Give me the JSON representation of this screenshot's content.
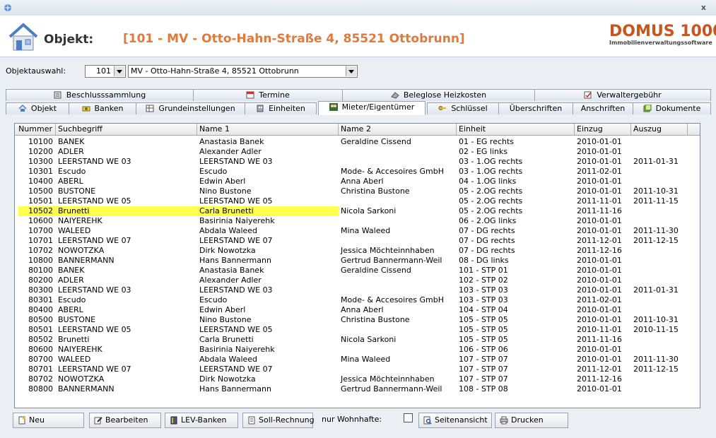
{
  "window": {
    "close_glyph": "x"
  },
  "header": {
    "label": "Objekt:",
    "title": "[101 - MV - Otto-Hahn-Straße 4, 85521 Ottobrunn]"
  },
  "logo": {
    "main": "DOMUS 1000",
    "reg": "®",
    "sub": "Immobilienverwaltungssoftware"
  },
  "selection": {
    "label": "Objektauswahl:",
    "number": "101",
    "text": "MV - Otto-Hahn-Straße 4, 85521 Ottobrunn"
  },
  "tabs_row1": [
    {
      "label": "Beschlusssammlung",
      "icon": "notebook-icon"
    },
    {
      "label": "Termine",
      "icon": "calendar-icon"
    },
    {
      "label": "Beleglose Heizkosten",
      "icon": "eraser-icon"
    },
    {
      "label": "Verwaltergebühr",
      "icon": "checklist-icon"
    }
  ],
  "tabs_row2": [
    {
      "label": "Objekt",
      "icon": "house-icon"
    },
    {
      "label": "Banken",
      "icon": "money-icon"
    },
    {
      "label": "Grundeinstellungen",
      "icon": "settings-grid-icon"
    },
    {
      "label": "Einheiten",
      "icon": "building-icon"
    },
    {
      "label": "Mieter/Eigentümer",
      "icon": "people-icon",
      "active": true
    },
    {
      "label": "Schlüssel",
      "icon": "key-icon"
    },
    {
      "label": "Überschriften",
      "icon": ""
    },
    {
      "label": "Anschriften",
      "icon": ""
    },
    {
      "label": "Dokumente",
      "icon": "documents-icon"
    }
  ],
  "table": {
    "columns": [
      "Nummer",
      "Suchbegriff",
      "Name 1",
      "Name 2",
      "Einheit",
      "Einzug",
      "Auszug"
    ],
    "rows": [
      [
        "10100",
        "BANEK",
        "Anastasia Banek",
        "Geraldine Cissend",
        "01 - EG rechts",
        "2010-01-01",
        ""
      ],
      [
        "10200",
        "ADLER",
        "Alexander Adler",
        "",
        "02 - EG links",
        "2010-01-01",
        ""
      ],
      [
        "10300",
        "LEERSTAND WE 03",
        "LEERSTAND WE 03",
        "",
        "03 - 1.OG rechts",
        "2010-01-01",
        "2011-01-31"
      ],
      [
        "10301",
        "Escudo",
        "Escudo",
        "Mode- & Accesoires GmbH",
        "03 - 1.OG rechts",
        "2011-02-01",
        ""
      ],
      [
        "10400",
        "ABERL",
        "Edwin Aberl",
        "Anna Aberl",
        "04 - 1.OG links",
        "2010-01-01",
        ""
      ],
      [
        "10500",
        "BUSTONE",
        "Nino Bustone",
        "Christina Bustone",
        "05 - 2.OG rechts",
        "2010-01-01",
        "2011-10-31"
      ],
      [
        "10501",
        "LEERSTAND WE 05",
        "LEERSTAND WE 05",
        "",
        "05 - 2.OG rechts",
        "2011-11-01",
        "2011-11-15"
      ],
      [
        "10502",
        "Brunetti",
        "Carla Brunetti",
        "Nicola Sarkoni",
        "05 - 2.OG rechts",
        "2011-11-16",
        ""
      ],
      [
        "10600",
        "NAIYEREHK",
        "Basirinia Naiyerehk",
        "",
        "06 - 2.OG links",
        "2010-01-01",
        ""
      ],
      [
        "10700",
        "WALEED",
        "Abdala Waleed",
        "Mina Waleed",
        "07 - DG rechts",
        "2010-01-01",
        "2011-11-30"
      ],
      [
        "10701",
        "LEERSTAND WE 07",
        "LEERSTAND WE 07",
        "",
        "07 - DG rechts",
        "2011-12-01",
        "2011-12-15"
      ],
      [
        "10702",
        "NOWOTZKA",
        "Dirk Nowotzka",
        "Jessica Möchteinnhaben",
        "07 - DG rechts",
        "2011-12-16",
        ""
      ],
      [
        "10800",
        "BANNERMANN",
        "Hans Bannermann",
        "Gertrud Bannermann-Weil",
        "08 - DG links",
        "2010-01-01",
        ""
      ],
      [
        "80100",
        "BANEK",
        "Anastasia Banek",
        "Geraldine Cissend",
        "101 - STP 01",
        "2010-01-01",
        ""
      ],
      [
        "80200",
        "ADLER",
        "Alexander Adler",
        "",
        "102 - STP 02",
        "2010-01-01",
        ""
      ],
      [
        "80300",
        "LEERSTAND WE 03",
        "LEERSTAND WE 03",
        "",
        "103 - STP 03",
        "2010-01-01",
        "2011-01-31"
      ],
      [
        "80301",
        "Escudo",
        "Escudo",
        "Mode- & Accesoires GmbH",
        "103 - STP 03",
        "2011-02-01",
        ""
      ],
      [
        "80400",
        "ABERL",
        "Edwin Aberl",
        "Anna Aberl",
        "104 - STP 04",
        "2010-01-01",
        ""
      ],
      [
        "80500",
        "BUSTONE",
        "Nino Bustone",
        "Christina Bustone",
        "105 - STP 05",
        "2010-01-01",
        "2011-10-31"
      ],
      [
        "80501",
        "LEERSTAND WE 05",
        "LEERSTAND WE 05",
        "",
        "105 - STP 05",
        "2010-11-01",
        "2010-11-15"
      ],
      [
        "80502",
        "Brunetti",
        "Carla Brunetti",
        "Nicola Sarkoni",
        "105 - STP 05",
        "2011-11-16",
        ""
      ],
      [
        "80600",
        "NAIYEREHK",
        "Basirinia Naiyerehk",
        "",
        "106 - STP 06",
        "2010-01-01",
        ""
      ],
      [
        "80700",
        "WALEED",
        "Abdala Waleed",
        "Mina Waleed",
        "107 - STP 07",
        "2010-01-01",
        "2011-11-30"
      ],
      [
        "80701",
        "LEERSTAND WE 07",
        "LEERSTAND WE 07",
        "",
        "107 - STP 07",
        "2011-12-01",
        "2011-12-15"
      ],
      [
        "80702",
        "NOWOTZKA",
        "Dirk Nowotzka",
        "Jessica Möchteinnhaben",
        "107 - STP 07",
        "2011-12-16",
        ""
      ],
      [
        "80800",
        "BANNERMANN",
        "Hans Bannermann",
        "Gertrud Bannermann-Weil",
        "108 - STP 08",
        "2010-01-01",
        ""
      ]
    ],
    "highlight_row": 7,
    "highlight_color": "#ffff4f"
  },
  "buttons": [
    {
      "label": "Neu",
      "name": "neu-button",
      "icon": "new-doc-icon"
    },
    {
      "label": "Bearbeiten",
      "name": "bearbeiten-button",
      "icon": "edit-icon"
    },
    {
      "label": "LEV-Banken",
      "name": "lev-banken-button",
      "icon": "book-icon"
    },
    {
      "label": "Soll-Rechnung",
      "name": "soll-rechnung-button",
      "icon": "invoice-icon"
    },
    {
      "label": "Seitenansicht",
      "name": "seitenansicht-button",
      "icon": "preview-icon"
    },
    {
      "label": "Drucken",
      "name": "drucken-button",
      "icon": "printer-icon"
    }
  ],
  "filter": {
    "label": "nur Wohnhafte:",
    "checked": false
  },
  "colors": {
    "accent": "#e07a3a",
    "logo": "#c9541c"
  }
}
